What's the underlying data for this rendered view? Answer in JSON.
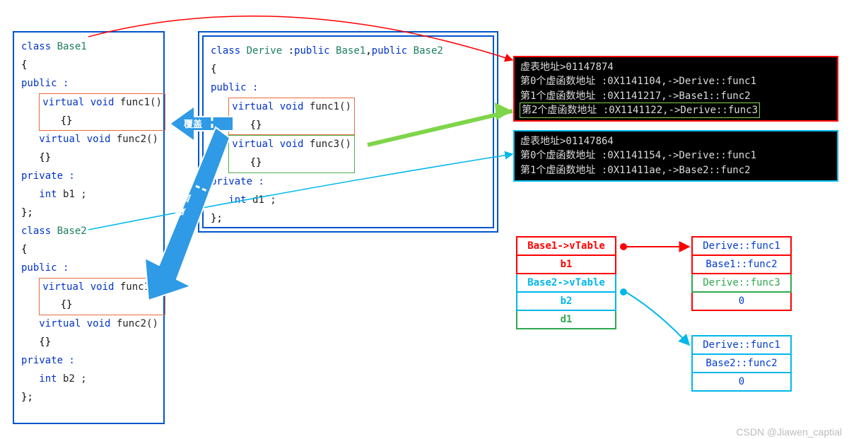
{
  "attribution": "CSDN @Jiawen_captial",
  "annotations": {
    "cover1": "覆盖",
    "cover2": "覆盖"
  },
  "code": {
    "base1": {
      "decl": "class Base1",
      "open": "{",
      "pub": "public :",
      "f1_sig": "virtual void func1()",
      "f1_body": "{}",
      "f2_sig": "virtual void func2()",
      "f2_body": "{}",
      "priv": "private :",
      "m": "int b1 ;",
      "close": "};"
    },
    "base2": {
      "decl": "class Base2",
      "open": "{",
      "pub": "public :",
      "f1_sig": "virtual void func1()",
      "f1_body": "{}",
      "f2_sig": "virtual void func2()",
      "f2_body": "{}",
      "priv": "private :",
      "m": "int b2 ;",
      "close": "};"
    },
    "derive": {
      "decl": "class Derive :public Base1,public Base2",
      "open": "{",
      "pub": "public :",
      "f1_sig": "virtual void func1()",
      "f1_body": "{}",
      "f3_sig": "virtual void func3()",
      "f3_body": "{}",
      "priv": "private :",
      "m": "int d1 ;",
      "close": "};"
    }
  },
  "console1": {
    "title": "虚表地址>01147874",
    "r0": "第0个虚函数地址 :0X1141104,->Derive::func1",
    "r1": "第1个虚函数地址 :0X1141217,->Base1::func2",
    "r2": "第2个虚函数地址 :0X1141122,->Derive::func3"
  },
  "console2": {
    "title": "虚表地址>01147864",
    "r0": "第0个虚函数地址 :0X1141154,->Derive::func1",
    "r1": "第1个虚函数地址 :0X11411ae,->Base2::func2"
  },
  "mem": {
    "obj": {
      "r0": "Base1->vTable",
      "r1": "b1",
      "r2": "Base2->vTable",
      "r3": "b2",
      "r4": "d1"
    },
    "vt1": {
      "r0": "Derive::func1",
      "r1": "Base1::func2",
      "r2": "Derive::func3",
      "r3": "0"
    },
    "vt2": {
      "r0": "Derive::func1",
      "r1": "Base2::func2",
      "r2": "0"
    }
  }
}
